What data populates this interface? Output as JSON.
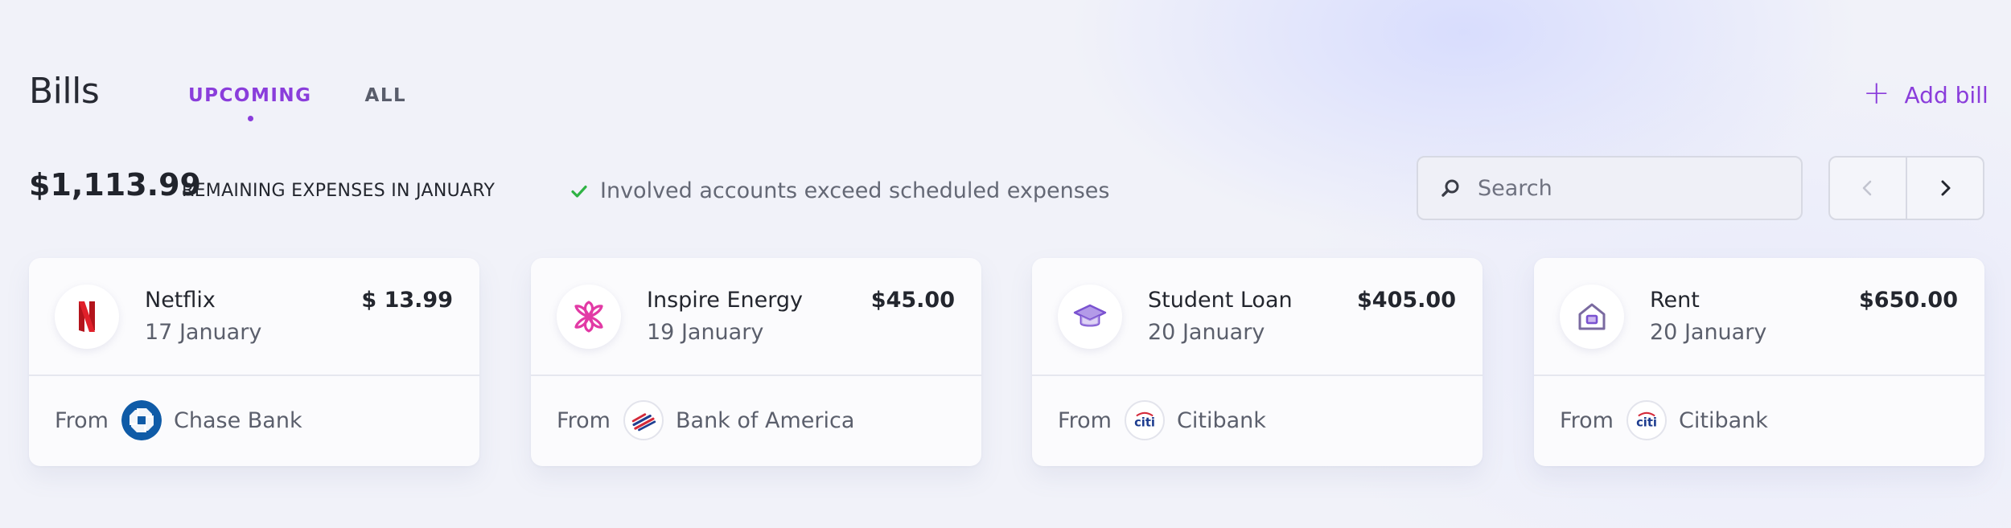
{
  "header": {
    "title": "Bills",
    "tabs": [
      {
        "label": "UPCOMING",
        "active": true
      },
      {
        "label": "ALL",
        "active": false
      }
    ],
    "add_label": "Add bill"
  },
  "summary": {
    "total": "$1,113.99",
    "remaining_label": "REMAINING EXPENSES IN JANUARY",
    "status_text": "Involved accounts exceed scheduled expenses"
  },
  "search": {
    "placeholder": "Search",
    "value": ""
  },
  "pager": {
    "prev_icon": "chevron-left-icon",
    "next_icon": "chevron-right-icon"
  },
  "colors": {
    "accent": "#8a3ddb",
    "success": "#2fb344",
    "netflix": "#d41b24",
    "energy": "#e23aa5",
    "loan": "#8a5fd6",
    "rent": "#7a6aa0",
    "chase": "#0f5ba7",
    "citi": "#1d3c8f"
  },
  "bills": [
    {
      "name": "Netflix",
      "date": "17 January",
      "amount": "$ 13.99",
      "from_label": "From",
      "bank": "Chase Bank",
      "icon": "netflix-logo-icon",
      "bank_icon": "chase-logo-icon"
    },
    {
      "name": "Inspire Energy",
      "date": "19 January",
      "amount": "$45.00",
      "from_label": "From",
      "bank": "Bank of America",
      "icon": "energy-asterisk-icon",
      "bank_icon": "bank-of-america-logo-icon"
    },
    {
      "name": "Student Loan",
      "date": "20 January",
      "amount": "$405.00",
      "from_label": "From",
      "bank": "Citibank",
      "icon": "graduation-cap-icon",
      "bank_icon": "citi-logo-icon"
    },
    {
      "name": "Rent",
      "date": "20 January",
      "amount": "$650.00",
      "from_label": "From",
      "bank": "Citibank",
      "icon": "house-icon",
      "bank_icon": "citi-logo-icon"
    }
  ],
  "bank_logo_text": {
    "citi": "citi"
  }
}
